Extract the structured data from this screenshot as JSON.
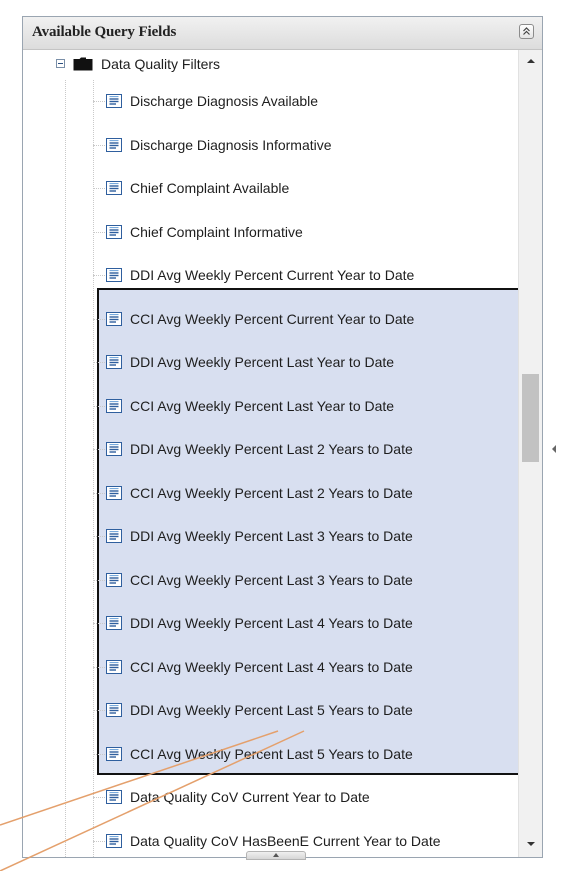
{
  "panel": {
    "title": "Available Query Fields",
    "collapse_icon": "double-chevron-up-icon"
  },
  "tree": {
    "folder": {
      "label": "Data Quality Filters",
      "expanded": true,
      "toggle_icon": "minus-box-icon",
      "icon": "folder-icon"
    },
    "items": [
      {
        "label": "Discharge Diagnosis Available",
        "selected": false
      },
      {
        "label": "Discharge Diagnosis Informative",
        "selected": false
      },
      {
        "label": "Chief Complaint Available",
        "selected": false
      },
      {
        "label": "Chief Complaint Informative",
        "selected": false
      },
      {
        "label": "DDI Avg Weekly Percent Current Year to Date",
        "selected": true
      },
      {
        "label": "CCI Avg Weekly Percent Current Year to Date",
        "selected": true
      },
      {
        "label": "DDI Avg Weekly Percent Last Year to Date",
        "selected": true
      },
      {
        "label": "CCI Avg Weekly Percent Last Year to Date",
        "selected": true
      },
      {
        "label": "DDI Avg Weekly Percent Last 2 Years to Date",
        "selected": true
      },
      {
        "label": "CCI Avg Weekly Percent Last 2 Years to Date",
        "selected": true
      },
      {
        "label": "DDI Avg Weekly Percent Last 3 Years to Date",
        "selected": true
      },
      {
        "label": "CCI Avg Weekly Percent Last 3 Years to Date",
        "selected": true
      },
      {
        "label": "DDI Avg Weekly Percent Last 4 Years to Date",
        "selected": true
      },
      {
        "label": "CCI Avg Weekly Percent Last 4 Years to Date",
        "selected": true
      },
      {
        "label": "DDI Avg Weekly Percent Last 5 Years to Date",
        "selected": true
      },
      {
        "label": "CCI Avg Weekly Percent Last 5 Years to Date",
        "selected": false
      },
      {
        "label": "Data Quality CoV Current Year to Date",
        "selected": false
      },
      {
        "label": "Data Quality CoV HasBeenE Current Year to Date",
        "selected": false
      }
    ]
  },
  "scrollbar": {
    "up_icon": "scroll-up-arrow-icon",
    "down_icon": "scroll-down-arrow-icon"
  },
  "colors": {
    "selection_fill": "#d8dff0",
    "selection_border": "#111111",
    "callout_line": "#e4a06c",
    "header_bg": "#e6e6e6"
  }
}
